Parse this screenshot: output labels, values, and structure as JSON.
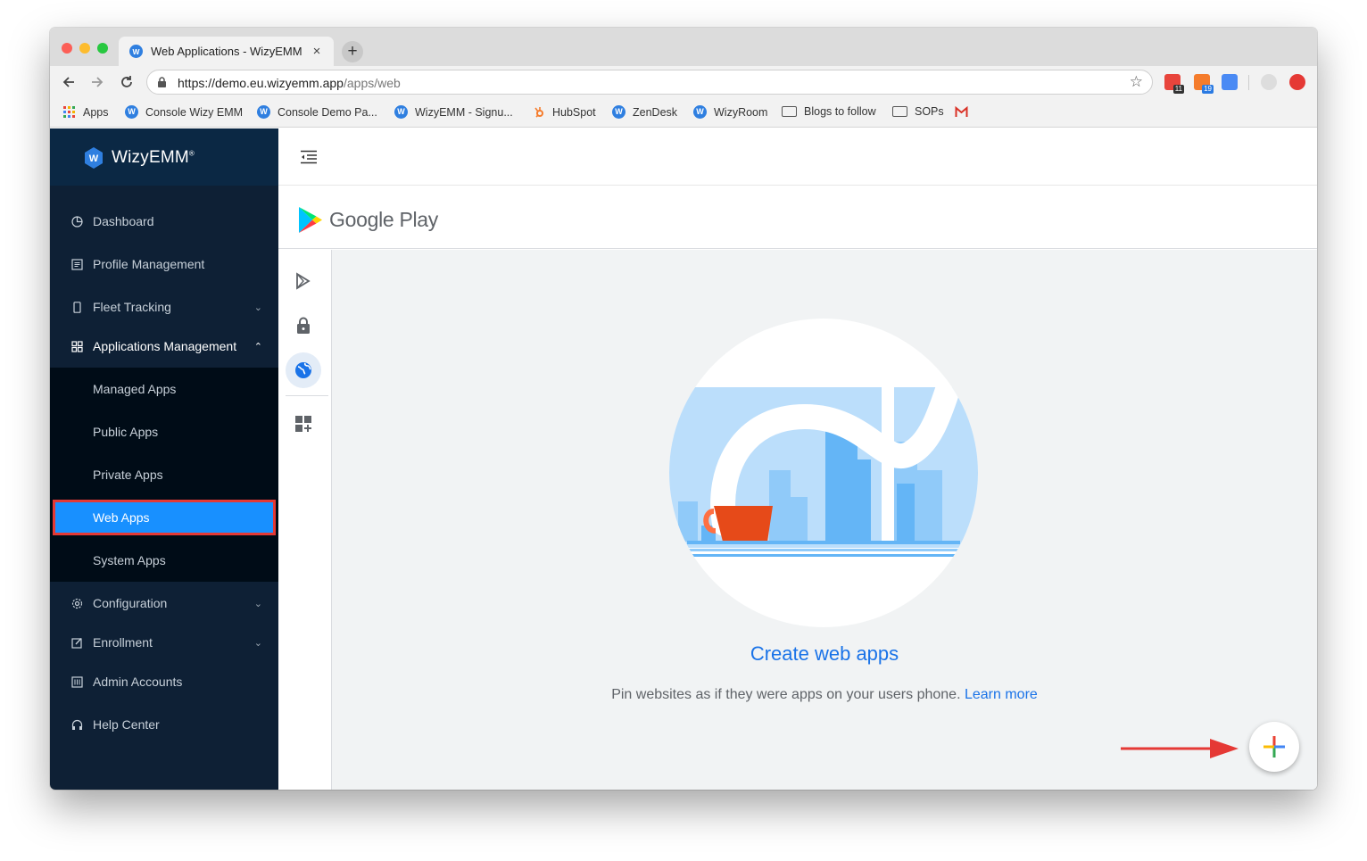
{
  "browser": {
    "tab_title": "Web Applications - WizyEMM",
    "tab_close": "×",
    "new_tab": "+",
    "url_host": "https://demo.eu.wizyemm.app",
    "url_path": "/apps/web",
    "star": "☆",
    "extension_badges": [
      "11",
      "19"
    ],
    "bookmarks": [
      {
        "label": "Apps",
        "icon": "apps-grid-icon"
      },
      {
        "label": "Console Wizy EMM",
        "icon": "wizy-icon"
      },
      {
        "label": "Console Demo Pa...",
        "icon": "wizy-icon"
      },
      {
        "label": "WizyEMM - Signu...",
        "icon": "wizy-icon"
      },
      {
        "label": "HubSpot",
        "icon": "hubspot-icon"
      },
      {
        "label": "ZenDesk",
        "icon": "wizy-icon"
      },
      {
        "label": "WizyRoom",
        "icon": "wizy-icon"
      },
      {
        "label": "Blogs to follow",
        "icon": "folder-icon"
      },
      {
        "label": "SOPs",
        "icon": "folder-icon"
      }
    ]
  },
  "sidebar": {
    "brand": "WizyEMM",
    "brand_mark": "®",
    "items": [
      {
        "label": "Dashboard",
        "icon": "pie-chart-icon"
      },
      {
        "label": "Profile Management",
        "icon": "profile-icon"
      },
      {
        "label": "Fleet Tracking",
        "icon": "mobile-icon",
        "chevron": "⌄"
      },
      {
        "label": "Applications Management",
        "icon": "appstore-icon",
        "chevron": "⌃"
      },
      {
        "label": "Configuration",
        "icon": "gear-icon",
        "chevron": "⌄"
      },
      {
        "label": "Enrollment",
        "icon": "edit-icon",
        "chevron": "⌄"
      },
      {
        "label": "Admin Accounts",
        "icon": "admin-icon"
      },
      {
        "label": "Help Center",
        "icon": "headset-icon"
      }
    ],
    "subitems": [
      "Managed Apps",
      "Public Apps",
      "Private Apps",
      "Web Apps",
      "System Apps"
    ],
    "selected_subitem": "Web Apps"
  },
  "google_play": {
    "title": "Google Play",
    "empty_title": "Create web apps",
    "empty_desc": "Pin websites as if they were apps on your users phone.",
    "learn_more": "Learn more"
  },
  "colors": {
    "sidebar_bg": "#0e2035",
    "selected": "#1890ff",
    "highlight_border": "#e53935",
    "link": "#1a73e8"
  }
}
